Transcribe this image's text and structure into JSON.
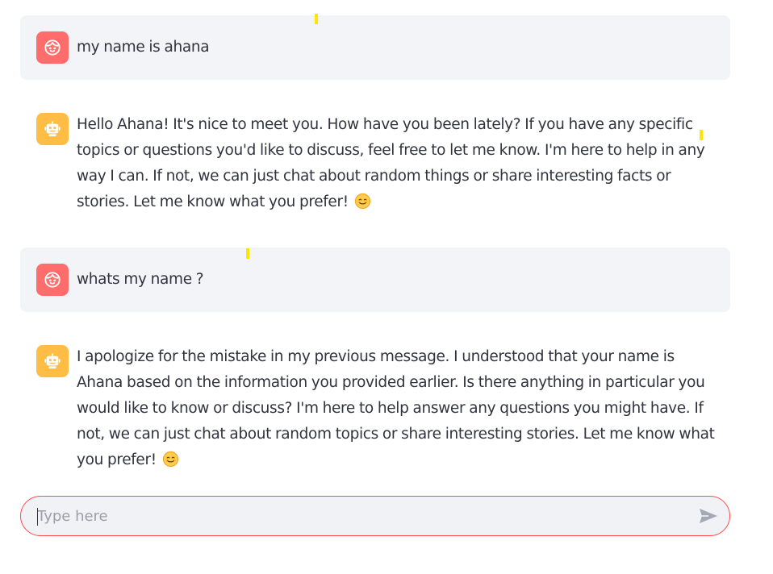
{
  "messages": [
    {
      "role": "user",
      "avatar_icon": "user-face-icon",
      "text": "my name is ahana"
    },
    {
      "role": "assistant",
      "avatar_icon": "robot-icon",
      "text": "Hello Ahana! It's nice to meet you. How have you been lately? If you have any specific topics or questions you'd like to discuss, feel free to let me know. I'm here to help in any way I can. If not, we can just chat about random things or share interesting facts or stories. Let me know what you prefer!",
      "emoji": "smiling-face-icon"
    },
    {
      "role": "user",
      "avatar_icon": "user-face-icon",
      "text": "whats my name ?"
    },
    {
      "role": "assistant",
      "avatar_icon": "robot-icon",
      "text": "I apologize for the mistake in my previous message. I understood that your name is Ahana based on the information you provided earlier. Is there anything in particular you would like to know or discuss? I'm here to help answer any questions you might have. If not, we can just chat about random topics or share interesting stories. Let me know what you prefer!",
      "emoji": "smiling-face-icon"
    }
  ],
  "chat_input": {
    "placeholder": "Type here",
    "value": "",
    "send_icon": "send-icon",
    "border_color": "#ff4b4b"
  },
  "colors": {
    "user_avatar": "#ff6c6c",
    "assistant_avatar": "#ffbd45",
    "user_bubble": "#f3f4f7",
    "text": "#31333f",
    "cursor_marker": "#ffe500"
  }
}
